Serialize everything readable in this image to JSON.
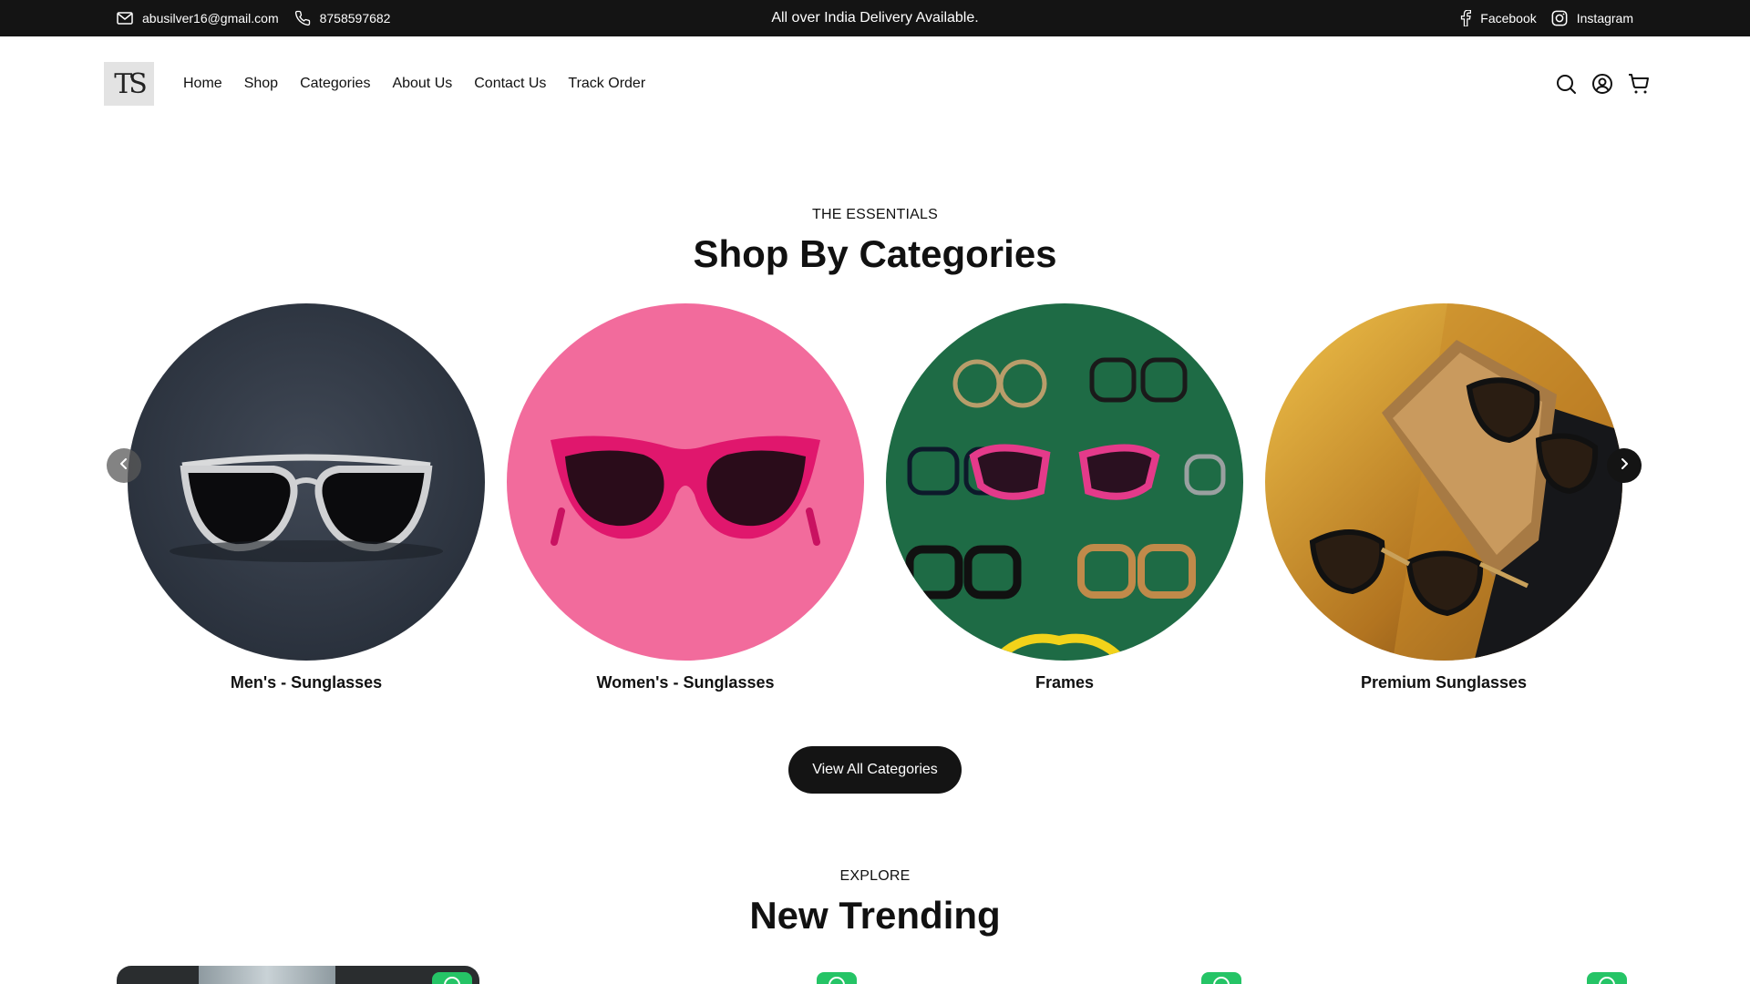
{
  "topbar": {
    "email": "abusilver16@gmail.com",
    "phone": "8758597682",
    "announcement": "All over India Delivery Available.",
    "facebook": "Facebook",
    "instagram": "Instagram"
  },
  "header": {
    "logo_text": "TS",
    "nav": [
      "Home",
      "Shop",
      "Categories",
      "About Us",
      "Contact Us",
      "Track Order"
    ],
    "icons": [
      "search-icon",
      "user-icon",
      "cart-icon"
    ]
  },
  "categories_section": {
    "eyebrow": "THE ESSENTIALS",
    "title": "Shop By Categories",
    "items": [
      {
        "name": "Men's - Sunglasses"
      },
      {
        "name": "Women's - Sunglasses"
      },
      {
        "name": "Frames"
      },
      {
        "name": "Premium Sunglasses"
      }
    ],
    "view_all": "View All Categories"
  },
  "trending_section": {
    "eyebrow": "EXPLORE",
    "title": "New Trending"
  },
  "colors": {
    "topbar_bg": "#141414",
    "button_bg": "#141414",
    "whatsapp_green": "#25c466",
    "women_pink": "#f26b9c",
    "frames_green": "#1e6b45"
  }
}
